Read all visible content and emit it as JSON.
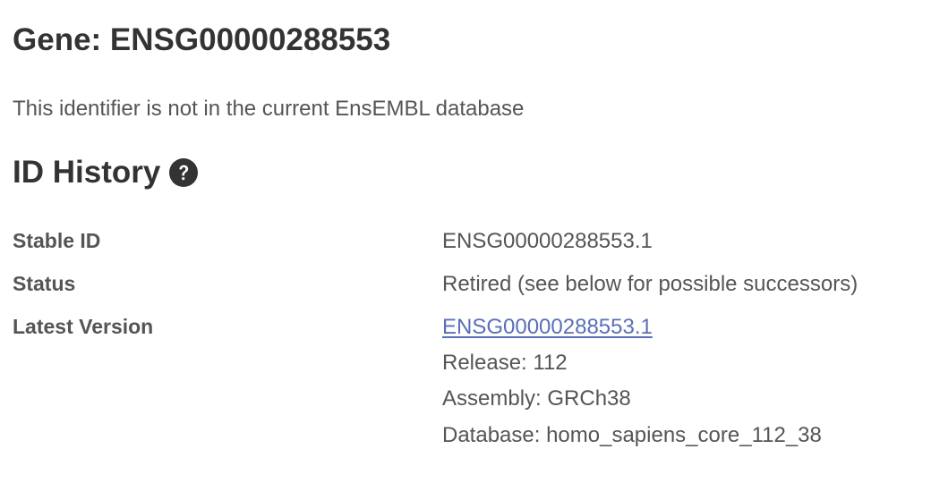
{
  "page": {
    "title": "Gene: ENSG00000288553",
    "notice": "This identifier is not in the current EnsEMBL database"
  },
  "id_history": {
    "heading": "ID History",
    "help_icon": "question-circle-icon",
    "rows": {
      "stable_id": {
        "label": "Stable ID",
        "value": "ENSG00000288553.1"
      },
      "status": {
        "label": "Status",
        "value": "Retired (see below for possible successors)"
      },
      "latest_version": {
        "label": "Latest Version",
        "link": "ENSG00000288553.1",
        "release": "Release: 112",
        "assembly": "Assembly: GRCh38",
        "database": "Database: homo_sapiens_core_112_38"
      }
    }
  },
  "colors": {
    "text_dark": "#333333",
    "text_muted": "#555555",
    "link": "#5a6fb8"
  }
}
